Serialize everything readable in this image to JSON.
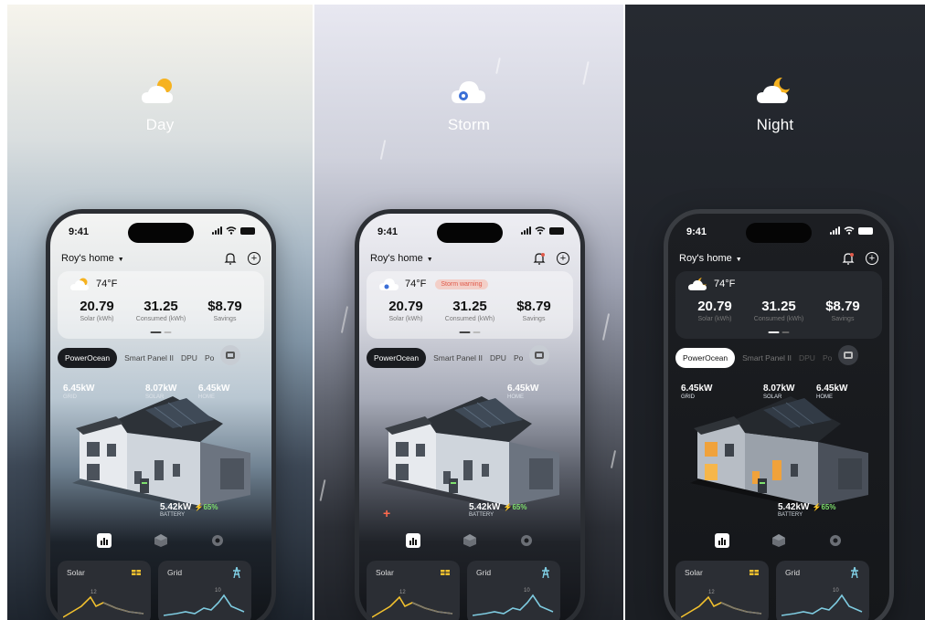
{
  "colors": {
    "accent_green": "#7ee06d",
    "warning_red": "#e05a4a",
    "solar_yellow": "#f2c12e",
    "grid_cyan": "#7ecbe0"
  },
  "panels": [
    {
      "id": "day",
      "label": "Day",
      "icon": "sun-behind-cloud-icon",
      "phone": {
        "time": "9:41",
        "home_name": "Roy's home",
        "temperature": "74°F",
        "warning": "",
        "stats": [
          {
            "value": "20.79",
            "label": "Solar (kWh)"
          },
          {
            "value": "31.25",
            "label": "Consumed (kWh)"
          },
          {
            "value": "$8.79",
            "label": "Savings"
          }
        ],
        "tabs": [
          "PowerOcean",
          "Smart Panel II",
          "DPU",
          "Po"
        ],
        "metrics": {
          "grid": {
            "value": "6.45kW",
            "label": "GRID"
          },
          "solar": {
            "value": "8.07kW",
            "label": "SOLAR"
          },
          "home": {
            "value": "6.45kW",
            "label": "HOME"
          },
          "battery": {
            "value": "5.42kW",
            "pct": "65%",
            "label": "BATTERY"
          }
        },
        "cards": [
          {
            "title": "Solar",
            "peak": "12"
          },
          {
            "title": "Grid",
            "peak": "10"
          }
        ]
      }
    },
    {
      "id": "storm",
      "label": "Storm",
      "icon": "storm-cloud-icon",
      "phone": {
        "time": "9:41",
        "home_name": "Roy's home",
        "temperature": "74°F",
        "warning": "Storm warning",
        "stats": [
          {
            "value": "20.79",
            "label": "Solar (kWh)"
          },
          {
            "value": "31.25",
            "label": "Consumed (kWh)"
          },
          {
            "value": "$8.79",
            "label": "Savings"
          }
        ],
        "tabs": [
          "PowerOcean",
          "Smart Panel II",
          "DPU",
          "Po"
        ],
        "metrics": {
          "home": {
            "value": "6.45kW",
            "label": "HOME"
          },
          "battery": {
            "value": "5.42kW",
            "pct": "65%",
            "label": "BATTERY"
          }
        },
        "cards": [
          {
            "title": "Solar",
            "peak": "12"
          },
          {
            "title": "Grid",
            "peak": "10"
          }
        ]
      }
    },
    {
      "id": "night",
      "label": "Night",
      "icon": "moon-behind-cloud-icon",
      "phone": {
        "time": "9:41",
        "home_name": "Roy's home",
        "temperature": "74°F",
        "warning": "",
        "stats": [
          {
            "value": "20.79",
            "label": "Solar (kWh)"
          },
          {
            "value": "31.25",
            "label": "Consumed (kWh)"
          },
          {
            "value": "$8.79",
            "label": "Savings"
          }
        ],
        "tabs": [
          "PowerOcean",
          "Smart Panel II",
          "DPU",
          "Po"
        ],
        "metrics": {
          "grid": {
            "value": "6.45kW",
            "label": "GRID"
          },
          "solar": {
            "value": "8.07kW",
            "label": "SOLAR"
          },
          "home": {
            "value": "6.45kW",
            "label": "HOME"
          },
          "battery": {
            "value": "5.42kW",
            "pct": "65%",
            "label": "BATTERY"
          }
        },
        "cards": [
          {
            "title": "Solar",
            "peak": "12"
          },
          {
            "title": "Grid",
            "peak": "10"
          }
        ]
      }
    }
  ]
}
